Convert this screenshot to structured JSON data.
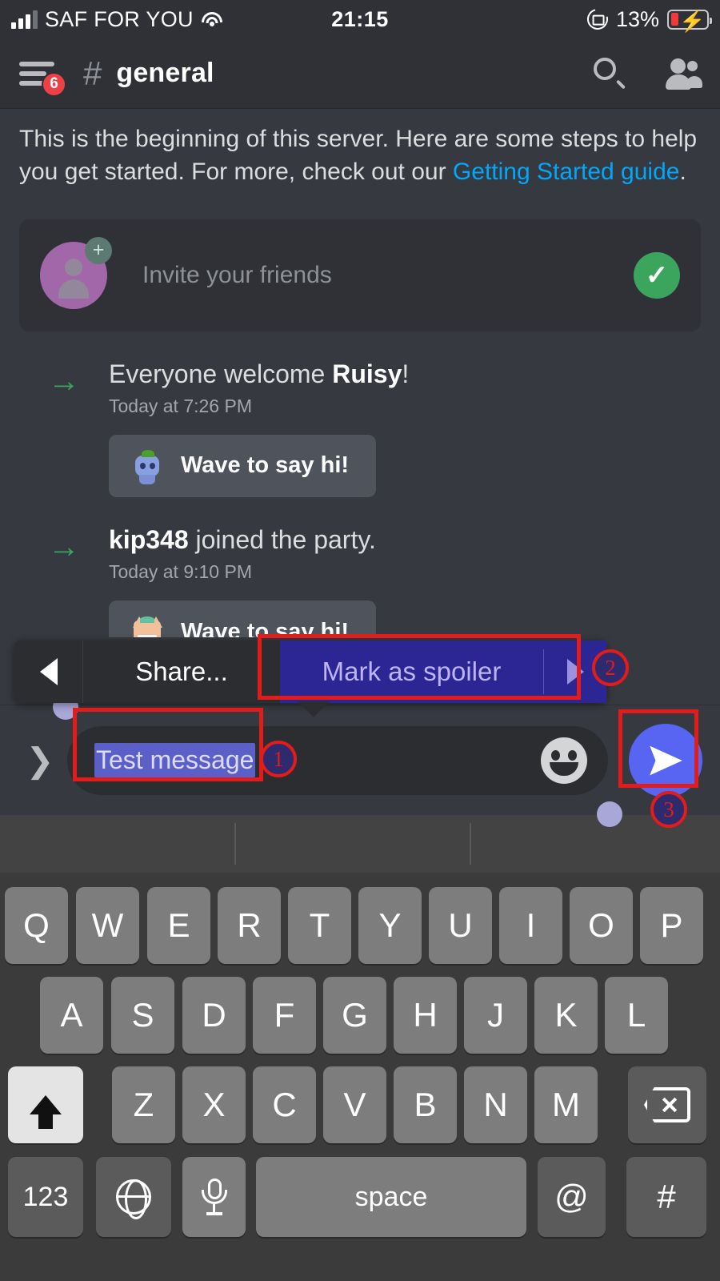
{
  "status_bar": {
    "carrier": "SAF FOR YOU",
    "time": "21:15",
    "battery_percent": "13%",
    "signal_bars_filled": 3,
    "signal_bars_total": 4,
    "icons": [
      "signal-icon",
      "wifi-icon",
      "rotation-lock-icon",
      "battery-charging-icon"
    ]
  },
  "channel_header": {
    "menu_badge_count": "6",
    "hash": "#",
    "channel_name": "general",
    "search_label": "search-icon",
    "members_label": "members-icon"
  },
  "chat": {
    "intro_text_before": "This is the beginning of this server. Here are some steps to help you get started. For more, check out our ",
    "intro_link": "Getting Started guide",
    "intro_text_after": ".",
    "invite_card": {
      "label": "Invite your friends",
      "completed_check": "✓"
    },
    "messages": [
      {
        "arrow": "→",
        "text_before": "Everyone welcome ",
        "username": "Ruisy",
        "text_after": "!",
        "timestamp": "Today at 7:26 PM",
        "wave_button": "Wave to say hi!"
      },
      {
        "arrow": "→",
        "text_before": "",
        "username": "kip348",
        "text_after": " joined the party.",
        "timestamp": "Today at 9:10 PM",
        "wave_button": "Wave to say hi!"
      }
    ]
  },
  "context_menu": {
    "prev_arrow": "◀",
    "items": [
      {
        "label": "Share...",
        "highlighted": false
      },
      {
        "label": "Mark as spoiler",
        "highlighted": true
      }
    ],
    "next_arrow": "▶",
    "highlight_color": "#2b2694",
    "highlight_text_color": "#bcb4f5"
  },
  "input_bar": {
    "expand_chevron": "❯",
    "message_text": "Test message",
    "text_selected": true,
    "emoji_button": "emoji-icon",
    "send_button": "send-icon",
    "send_button_color": "#5865f2"
  },
  "keyboard": {
    "rows": [
      [
        "Q",
        "W",
        "E",
        "R",
        "T",
        "Y",
        "U",
        "I",
        "O",
        "P"
      ],
      [
        "A",
        "S",
        "D",
        "F",
        "G",
        "H",
        "J",
        "K",
        "L"
      ],
      [
        "shift",
        "Z",
        "X",
        "C",
        "V",
        "B",
        "N",
        "M",
        "backspace"
      ],
      [
        "123",
        "globe",
        "mic",
        "space",
        "@",
        "#"
      ]
    ],
    "space_label": "space",
    "numbers_label": "123",
    "shift_label": "shift-icon",
    "backspace_label": "backspace-icon",
    "globe_label": "globe-icon",
    "mic_label": "microphone-icon",
    "at_label": "@",
    "hash_label": "#"
  },
  "annotations": {
    "accent_color": "#e21b1b",
    "markers": [
      {
        "number": "1",
        "target": "message-input-selected-text"
      },
      {
        "number": "2",
        "target": "mark-as-spoiler-menu-item"
      },
      {
        "number": "3",
        "target": "send-button"
      }
    ]
  }
}
